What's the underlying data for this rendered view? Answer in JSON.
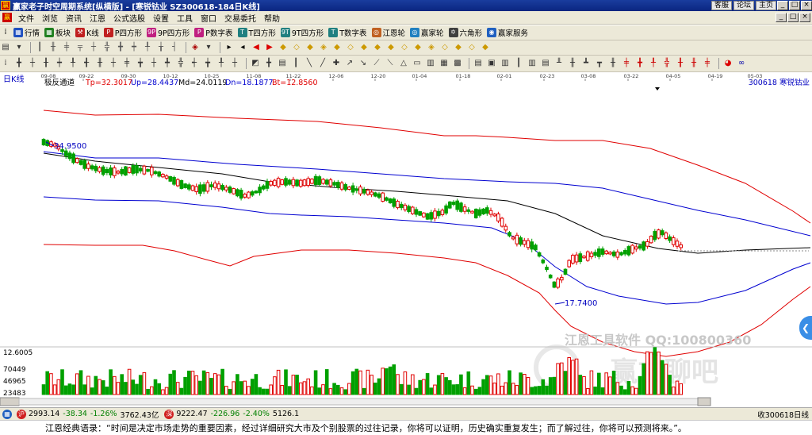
{
  "window": {
    "title": "赢家老子时空周期系统[纵横版] - [寒锐钴业  SZ300618-184日K线]",
    "links": [
      "客服",
      "论坛",
      "主页"
    ],
    "controls": [
      "_",
      "□",
      "×"
    ]
  },
  "menu": {
    "items": [
      "文件",
      "浏览",
      "资讯",
      "江恩",
      "公式选股",
      "设置",
      "工具",
      "窗口",
      "交易委托",
      "帮助"
    ],
    "right_controls": [
      "_",
      "□",
      "×"
    ]
  },
  "toolbar1": {
    "items": [
      {
        "label": "行情",
        "color": "#2050c0",
        "glyph": "▦"
      },
      {
        "label": "板块",
        "color": "#208020",
        "glyph": "▦"
      },
      {
        "label": "K线",
        "color": "#c02020",
        "glyph": "⚒"
      },
      {
        "label": "P四方形",
        "color": "#c02020",
        "glyph": "P"
      },
      {
        "label": "9P四方形",
        "color": "#c02080",
        "glyph": "9P"
      },
      {
        "label": "P数字表",
        "color": "#c02080",
        "glyph": "P"
      },
      {
        "label": "T四方形",
        "color": "#208080",
        "glyph": "T"
      },
      {
        "label": "9T四方形",
        "color": "#208080",
        "glyph": "9T"
      },
      {
        "label": "T数字表",
        "color": "#208080",
        "glyph": "T"
      },
      {
        "label": "江恩轮",
        "color": "#c06020",
        "glyph": "◎"
      },
      {
        "label": "赢家轮",
        "color": "#2080c0",
        "glyph": "◎"
      },
      {
        "label": "六角形",
        "color": "#404040",
        "glyph": "✡"
      },
      {
        "label": "赢家服务",
        "color": "#2060c0",
        "glyph": "◉"
      }
    ]
  },
  "chart": {
    "period_label": "日K线",
    "indicator_name": "极反通道",
    "tp": "Tp=32.3017",
    "up": "Up=28.4437",
    "md": "Md=24.0119",
    "dn": "Dn=18.1877",
    "bt": "Bt=12.8560",
    "stock_label": "300618  寒锐钴业",
    "high_label": "34.9500",
    "low_label": "17.7400",
    "volume_label": "12.6005",
    "vol_ticks": [
      "70449",
      "46965",
      "23483"
    ],
    "date_ticks": [
      "09-08",
      "09-22",
      "09-30",
      "10-12",
      "10-25",
      "11-08",
      "11-22",
      "12-06",
      "12-20",
      "01-04",
      "01-18",
      "02-01",
      "02-23",
      "03-08",
      "03-22",
      "04-05",
      "04-19",
      "05-03"
    ],
    "watermark1": "江恩工具软件  QQ:100800360",
    "watermark2": "赢友聊吧",
    "colors": {
      "up": "#e00000",
      "down": "#00a000",
      "mid": "#000000",
      "inner": "#0000d0",
      "outer": "#e00000"
    }
  },
  "chart_data": {
    "type": "candlestick",
    "channel": {
      "tp": 32.3017,
      "up": 28.4437,
      "md": 24.0119,
      "dn": 18.1877,
      "bt": 12.856
    },
    "high": 34.95,
    "low": 17.74,
    "x_ticks": [
      "09-08",
      "09-22",
      "09-30",
      "10-12",
      "10-25",
      "11-08",
      "11-22",
      "12-06",
      "12-20",
      "01-04",
      "01-18",
      "02-01",
      "02-23",
      "03-08",
      "03-22",
      "04-05",
      "04-19",
      "05-03"
    ],
    "volume_ticks": [
      70449,
      46965,
      23483
    ]
  },
  "status": {
    "sh_index": "2993.14",
    "sh_change": "-38.34",
    "sh_pct": "-1.26%",
    "sh_amount": "3762.43亿",
    "sz_index": "9222.47",
    "sz_change": "-226.96",
    "sz_pct": "-2.40%",
    "sz_amount": "5126.1",
    "right_text": "收300618日线"
  },
  "quote": {
    "text": "江恩经典语录：“时间是决定市场走势的重要因素，经过详细研究大市及个别股票的过往记录，你将可以证明，历史确实重复发生；而了解过往，你将可以预测将来。”。"
  }
}
